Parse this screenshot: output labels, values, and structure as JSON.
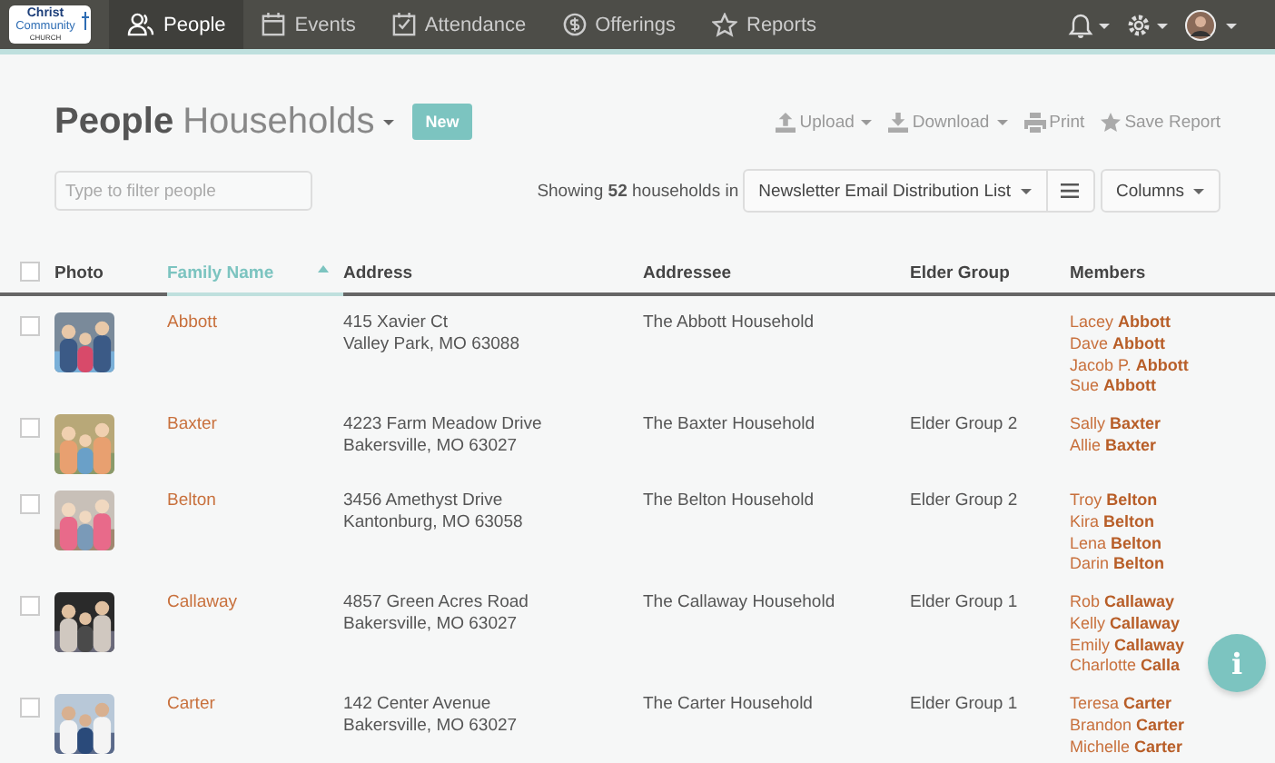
{
  "nav": {
    "logo": {
      "line1": "Christ",
      "line2": "Community",
      "line3": "CHURCH"
    },
    "tabs": [
      {
        "label": "People",
        "selected": true
      },
      {
        "label": "Events",
        "selected": false
      },
      {
        "label": "Attendance",
        "selected": false
      },
      {
        "label": "Offerings",
        "selected": false
      },
      {
        "label": "Reports",
        "selected": false
      }
    ]
  },
  "header": {
    "title": "People",
    "view": "Households",
    "new_button": "New",
    "actions": [
      {
        "label": "Upload",
        "dropdown": true
      },
      {
        "label": "Download",
        "dropdown": true
      },
      {
        "label": "Print",
        "dropdown": false
      },
      {
        "label": "Save Report",
        "dropdown": false
      }
    ]
  },
  "toolbar": {
    "filter": {
      "placeholder": "Type to filter people"
    },
    "summary": "Showing **52** households in",
    "list": "Newsletter Email Distribution List",
    "columns_button": "Columns"
  },
  "table": {
    "all_checked": false,
    "columns": [
      {
        "label": "Photo",
        "sorted": false
      },
      {
        "label": "Family Name",
        "sorted": true
      },
      {
        "label": "Address",
        "sorted": false
      },
      {
        "label": "Addressee",
        "sorted": false
      },
      {
        "label": "Elder Group",
        "sorted": false
      },
      {
        "label": "Members",
        "sorted": false
      }
    ],
    "rows": [
      {
        "checked": false,
        "family": "Abbott",
        "address": [
          "415 Xavier Ct",
          "Valley Park, MO   63088"
        ],
        "addressee": "The Abbott Household",
        "members": [
          "Lacey **Abbott**",
          "Dave **Abbott**",
          "Jacob P. **Abbott**",
          "Sue **Abbott**"
        ]
      },
      {
        "checked": false,
        "family": "Baxter",
        "address": [
          "4223 Farm Meadow Drive",
          "Bakersville, MO   63027"
        ],
        "addressee": "The Baxter Household",
        "elder_group": "Elder Group 2",
        "members": [
          "Sally **Baxter**",
          "Allie **Baxter**"
        ]
      },
      {
        "checked": false,
        "family": "Belton",
        "address": [
          "3456 Amethyst Drive",
          "Kantonburg, MO   63058"
        ],
        "addressee": "The Belton Household",
        "elder_group": "Elder Group 2",
        "members": [
          "Troy **Belton**",
          "Kira **Belton**",
          "Lena **Belton**",
          "Darin **Belton**"
        ]
      },
      {
        "checked": false,
        "family": "Callaway",
        "address": [
          "4857 Green Acres Road",
          "Bakersville, MO   63027"
        ],
        "addressee": "The Callaway Household",
        "elder_group": "Elder Group 1",
        "members": [
          "Rob **Callaway**",
          "Kelly **Callaway**",
          "Emily **Callaway**",
          "Charlotte **Calla**"
        ]
      },
      {
        "checked": false,
        "family": "Carter",
        "address": [
          "142 Center Avenue",
          "Bakersville, MO   63027"
        ],
        "addressee": "The Carter Household",
        "elder_group": "Elder Group 1",
        "members": [
          "Teresa **Carter**",
          "Brandon **Carter**",
          "Michelle **Carter**"
        ]
      }
    ]
  },
  "info_button": "i"
}
